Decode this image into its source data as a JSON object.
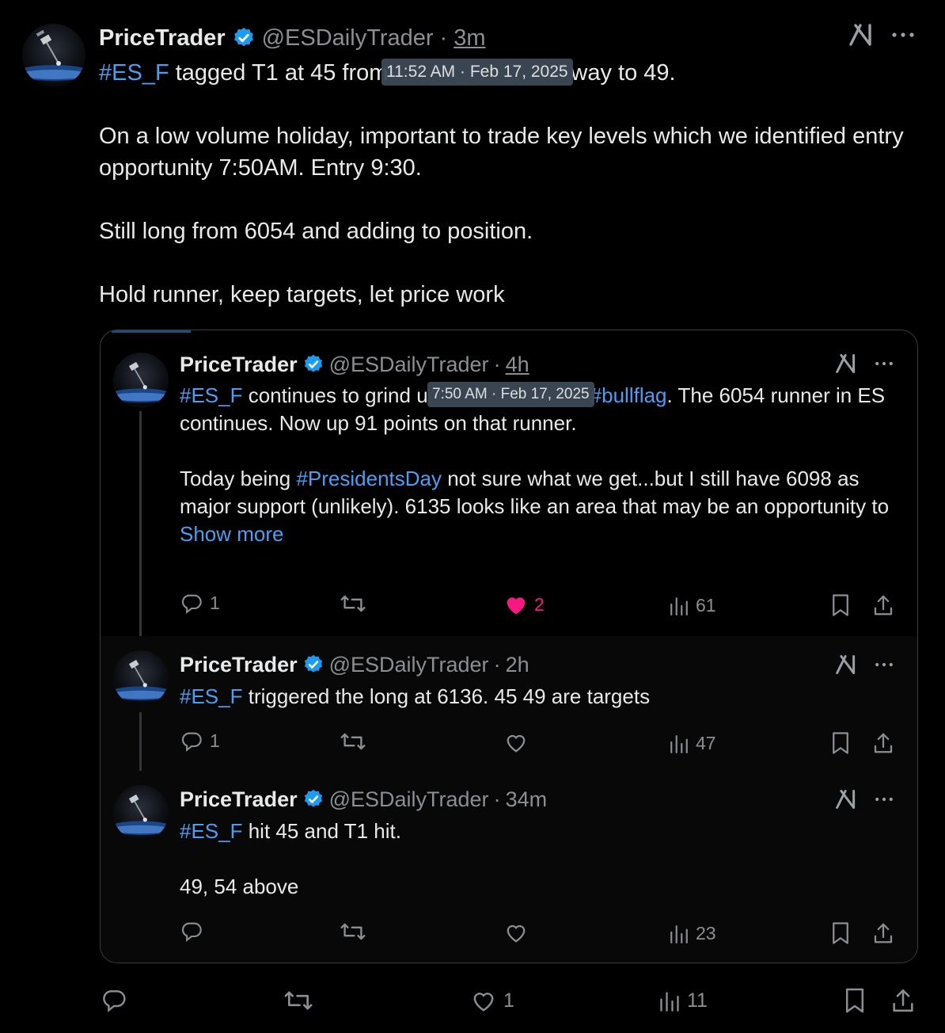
{
  "main": {
    "name": "PriceTrader",
    "handle": "@ESDailyTrader",
    "sep": "·",
    "time": "3m",
    "tooltip": "11:52 AM · Feb 17, 2025",
    "line1_tag": "#ES_F",
    "line1_before": " tagged T1 at 45 from",
    "line1_after": "way to 49.",
    "para2": "On a low volume holiday, important to trade key levels which we identified entry opportunity 7:50AM. Entry 9:30.",
    "para3": "Still long from 6054 and adding to position.",
    "para4": "Hold runner, keep targets, let price work",
    "replies": "",
    "likes": "1",
    "views": "11"
  },
  "thread": [
    {
      "name": "PriceTrader",
      "handle": "@ESDailyTrader",
      "sep": "·",
      "time": "4h",
      "tooltip": "7:50 AM · Feb 17, 2025",
      "tag": "#ES_F",
      "text_before": " continues to grind u",
      "tag2": "#bullflag",
      "text_after": ". The 6054 runner in ES continues. Now up 91 points on that runner.",
      "p2_before": "Today being ",
      "p2_tag": "#PresidentsDay",
      "p2_after": " not sure what we get...but I still have 6098 as major support (unlikely). 6135 looks like an area that may be an opportunity to",
      "show_more": "Show more",
      "replies": "1",
      "likes": "2",
      "views": "61"
    },
    {
      "name": "PriceTrader",
      "handle": "@ESDailyTrader",
      "sep": "·",
      "time": "2h",
      "tag": "#ES_F",
      "text": " triggered the long at 6136. 45 49 are targets",
      "replies": "1",
      "views": "47"
    },
    {
      "name": "PriceTrader",
      "handle": "@ESDailyTrader",
      "sep": "·",
      "time": "34m",
      "tag": "#ES_F",
      "text": " hit 45 and T1 hit.",
      "p2": "49, 54 above",
      "views": "23"
    }
  ],
  "colors": {
    "link": "#4a9ff5",
    "like_active": "#f91880",
    "muted": "#8b8f94",
    "verified": "#1d9bf0"
  },
  "icons": [
    "verified-badge-icon",
    "grok-icon",
    "more-icon",
    "reply-icon",
    "repost-icon",
    "like-icon",
    "views-icon",
    "bookmark-icon",
    "share-icon"
  ]
}
